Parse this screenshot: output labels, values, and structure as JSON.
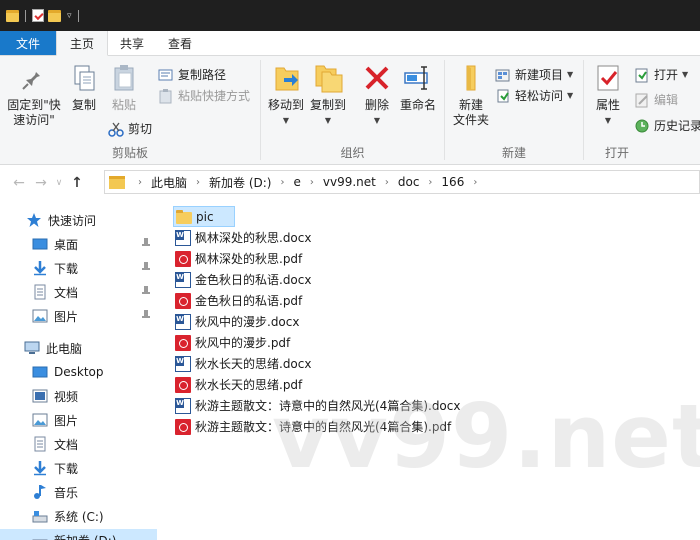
{
  "ribbon_tabs": {
    "file": "文件",
    "home": "主页",
    "share": "共享",
    "view": "查看"
  },
  "clipboard": {
    "pin_quick_access": "固定到\"快\n速访问\"",
    "copy": "复制",
    "paste": "粘贴",
    "copy_path": "复制路径",
    "paste_shortcut": "粘贴快捷方式",
    "cut": "剪切",
    "label": "剪贴板"
  },
  "organize": {
    "move_to": "移动到",
    "copy_to": "复制到",
    "delete": "删除",
    "rename": "重命名",
    "label": "组织"
  },
  "new": {
    "new_folder": "新建\n文件夹",
    "new_item": "新建项目",
    "easy_access": "轻松访问",
    "label": "新建"
  },
  "open": {
    "properties": "属性",
    "open": "打开",
    "edit": "编辑",
    "history": "历史记录",
    "label": "打开"
  },
  "breadcrumb": [
    "此电脑",
    "新加卷 (D:)",
    "e",
    "vv99.net",
    "doc",
    "166"
  ],
  "nav_pane": {
    "quick_access": "快速访问",
    "qa_items": [
      "桌面",
      "下载",
      "文档",
      "图片"
    ],
    "this_pc": "此电脑",
    "pc_items": [
      "Desktop",
      "视频",
      "图片",
      "文档",
      "下载",
      "音乐",
      "系统 (C:)",
      "新加卷 (D:)"
    ]
  },
  "files": [
    {
      "name": "pic",
      "type": "folder"
    },
    {
      "name": "枫林深处的秋思.docx",
      "type": "docx"
    },
    {
      "name": "枫林深处的秋思.pdf",
      "type": "pdf"
    },
    {
      "name": "金色秋日的私语.docx",
      "type": "docx"
    },
    {
      "name": "金色秋日的私语.pdf",
      "type": "pdf"
    },
    {
      "name": "秋风中的漫步.docx",
      "type": "docx"
    },
    {
      "name": "秋风中的漫步.pdf",
      "type": "pdf"
    },
    {
      "name": "秋水长天的思绪.docx",
      "type": "docx"
    },
    {
      "name": "秋水长天的思绪.pdf",
      "type": "pdf"
    },
    {
      "name": "秋游主题散文：诗意中的自然风光(4篇合集).docx",
      "type": "docx"
    },
    {
      "name": "秋游主题散文：诗意中的自然风光(4篇合集).pdf",
      "type": "pdf"
    }
  ],
  "watermark": "vv99.net",
  "colors": {
    "accent": "#1979ca",
    "selection": "#cce8ff",
    "folder": "#f6cd5e",
    "pdf": "#d9232e",
    "word": "#2b5797"
  }
}
